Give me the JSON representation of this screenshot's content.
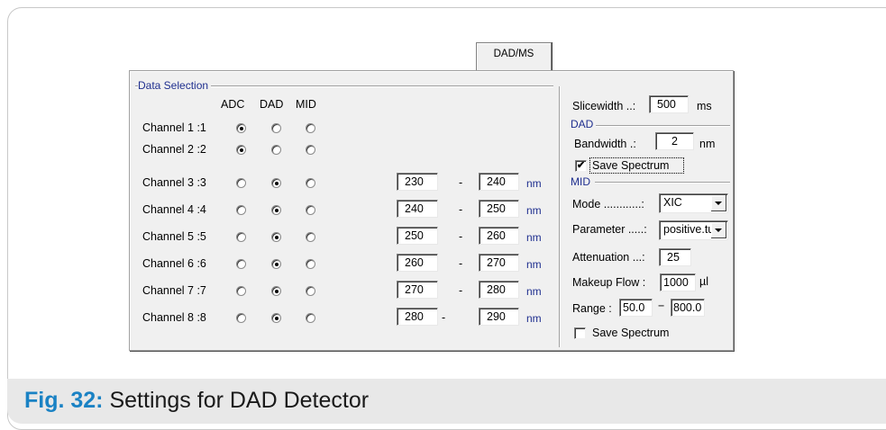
{
  "tab_label": "DAD/MS",
  "data_selection": {
    "title": "Data Selection",
    "col_headers": [
      "ADC",
      "DAD",
      "MID"
    ],
    "channels": [
      {
        "label": "Channel 1 :1",
        "selected": "ADC",
        "from": "",
        "to": "",
        "unit": ""
      },
      {
        "label": "Channel 2 :2",
        "selected": "ADC",
        "from": "",
        "to": "",
        "unit": ""
      },
      {
        "label": "Channel 3 :3",
        "selected": "DAD",
        "from": "230",
        "to": "240",
        "unit": "nm"
      },
      {
        "label": "Channel 4 :4",
        "selected": "DAD",
        "from": "240",
        "to": "250",
        "unit": "nm"
      },
      {
        "label": "Channel 5 :5",
        "selected": "DAD",
        "from": "250",
        "to": "260",
        "unit": "nm"
      },
      {
        "label": "Channel 6 :6",
        "selected": "DAD",
        "from": "260",
        "to": "270",
        "unit": "nm"
      },
      {
        "label": "Channel 7 :7",
        "selected": "DAD",
        "from": "270",
        "to": "280",
        "unit": "nm"
      },
      {
        "label": "Channel 8 :8",
        "selected": "DAD",
        "from": "280",
        "to": "290",
        "unit": "nm"
      }
    ],
    "range_sep": "-"
  },
  "slicewidth": {
    "label": "Slicewidth ..:",
    "value": "500",
    "unit": "ms"
  },
  "dad": {
    "title": "DAD",
    "bandwidth_label": "Bandwidth .:",
    "bandwidth_value": "2",
    "bandwidth_unit": "nm",
    "save_spectrum_label": "Save Spectrum",
    "save_spectrum_checked": true
  },
  "mid": {
    "title": "MID",
    "mode_label": "Mode ............:",
    "mode_value": "XIC",
    "parameter_label": "Parameter .....:",
    "parameter_value": "positive.tu",
    "attenuation_label": "Attenuation ...:",
    "attenuation_value": "25",
    "makeup_label": "Makeup Flow :",
    "makeup_value": "1000",
    "makeup_unit": "µl",
    "range_label": "Range :",
    "range_from": "50.0",
    "range_sep": "−",
    "range_to": "800.0",
    "save_spectrum_label": "Save Spectrum",
    "save_spectrum_checked": false
  },
  "caption": {
    "number": "Fig. 32:",
    "text": "Settings for DAD Detector"
  }
}
